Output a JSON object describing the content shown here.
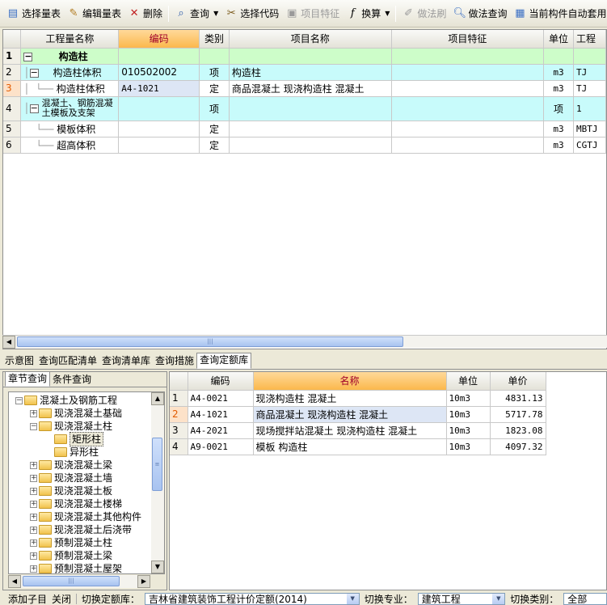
{
  "toolbar": {
    "items": [
      {
        "label": "选择量表",
        "icon": "select-table-icon",
        "disabled": false
      },
      {
        "label": "编辑量表",
        "icon": "edit-table-icon",
        "disabled": false
      },
      {
        "label": "删除",
        "icon": "delete-icon",
        "disabled": false
      },
      {
        "label": "查询",
        "icon": "search-icon",
        "disabled": false,
        "dropdown": true
      },
      {
        "label": "选择代码",
        "icon": "select-code-icon",
        "disabled": false
      },
      {
        "label": "项目特征",
        "icon": "project-feature-icon",
        "disabled": true
      },
      {
        "label": "换算",
        "icon": "fx-icon",
        "disabled": false,
        "dropdown": true
      },
      {
        "label": "做法刷",
        "icon": "brush-icon",
        "disabled": true
      },
      {
        "label": "做法查询",
        "icon": "method-query-icon",
        "disabled": false
      },
      {
        "label": "当前构件自动套用",
        "icon": "auto-apply-icon",
        "disabled": false
      }
    ]
  },
  "top_grid": {
    "columns": [
      "工程量名称",
      "编码",
      "类别",
      "项目名称",
      "项目特征",
      "单位",
      "工程"
    ],
    "rows": [
      {
        "num": "1",
        "name": "构造柱",
        "code": "",
        "type": "",
        "proj": "",
        "feature": "",
        "unit": "",
        "expr": "",
        "style": "group"
      },
      {
        "num": "2",
        "name": "构造柱体积",
        "code": "010502002",
        "type": "项",
        "proj": "构造柱",
        "feature": "",
        "unit": "m3",
        "expr": "TJ",
        "style": "item"
      },
      {
        "num": "3",
        "name": "构造柱体积",
        "code": "A4-1021",
        "type": "定",
        "proj": "商品混凝土 现浇构造柱 混凝土",
        "feature": "",
        "unit": "m3",
        "expr": "TJ",
        "style": "quota"
      },
      {
        "num": "4",
        "name": "混凝土、钢筋混凝土模板及支架",
        "code": "",
        "type": "项",
        "proj": "",
        "feature": "",
        "unit": "项",
        "expr": "1",
        "style": "item"
      },
      {
        "num": "5",
        "name": "模板体积",
        "code": "",
        "type": "定",
        "proj": "",
        "feature": "",
        "unit": "m3",
        "expr": "MBTJ",
        "style": "quota"
      },
      {
        "num": "6",
        "name": "超高体积",
        "code": "",
        "type": "定",
        "proj": "",
        "feature": "",
        "unit": "m3",
        "expr": "CGTJ",
        "style": "quota"
      }
    ]
  },
  "bottom_tabs": [
    "示意图",
    "查询匹配清单",
    "查询清单库",
    "查询措施",
    "查询定额库"
  ],
  "left_tabs": [
    "章节查询",
    "条件查询"
  ],
  "tree": [
    {
      "label": "混凝土及钢筋工程",
      "level": 0,
      "toggle": "-"
    },
    {
      "label": "现浇混凝土基础",
      "level": 1,
      "toggle": "+"
    },
    {
      "label": "现浇混凝土柱",
      "level": 1,
      "toggle": "-"
    },
    {
      "label": "矩形柱",
      "level": 2,
      "toggle": "",
      "selected": true
    },
    {
      "label": "异形柱",
      "level": 2,
      "toggle": ""
    },
    {
      "label": "现浇混凝土梁",
      "level": 1,
      "toggle": "+"
    },
    {
      "label": "现浇混凝土墙",
      "level": 1,
      "toggle": "+"
    },
    {
      "label": "现浇混凝土板",
      "level": 1,
      "toggle": "+"
    },
    {
      "label": "现浇混凝土楼梯",
      "level": 1,
      "toggle": "+"
    },
    {
      "label": "现浇混凝土其他构件",
      "level": 1,
      "toggle": "+"
    },
    {
      "label": "现浇混凝土后浇带",
      "level": 1,
      "toggle": "+"
    },
    {
      "label": "预制混凝土柱",
      "level": 1,
      "toggle": "+"
    },
    {
      "label": "预制混凝土梁",
      "level": 1,
      "toggle": "+"
    },
    {
      "label": "预制混凝土屋架",
      "level": 1,
      "toggle": "+"
    }
  ],
  "quota_grid": {
    "columns": [
      "编码",
      "名称",
      "单位",
      "单价"
    ],
    "rows": [
      {
        "num": "1",
        "code": "A4-0021",
        "name": "现浇构造柱 混凝土",
        "unit": "10m3",
        "price": "4831.13"
      },
      {
        "num": "2",
        "code": "A4-1021",
        "name": "商品混凝土 现浇构造柱 混凝土",
        "unit": "10m3",
        "price": "5717.78"
      },
      {
        "num": "3",
        "code": "A4-2021",
        "name": "现场搅拌站混凝土 现浇构造柱 混凝土",
        "unit": "10m3",
        "price": "1823.08"
      },
      {
        "num": "4",
        "code": "A9-0021",
        "name": "模板 构造柱",
        "unit": "10m3",
        "price": "4097.32"
      }
    ]
  },
  "statusbar": {
    "add_child": "添加子目",
    "close": "关闭",
    "switch_quota_label": "切换定额库：",
    "quota_lib": "吉林省建筑装饰工程计价定额(2014)",
    "switch_major_label": "切换专业：",
    "major": "建筑工程",
    "switch_type_label": "切换类别：",
    "type": "全部"
  }
}
